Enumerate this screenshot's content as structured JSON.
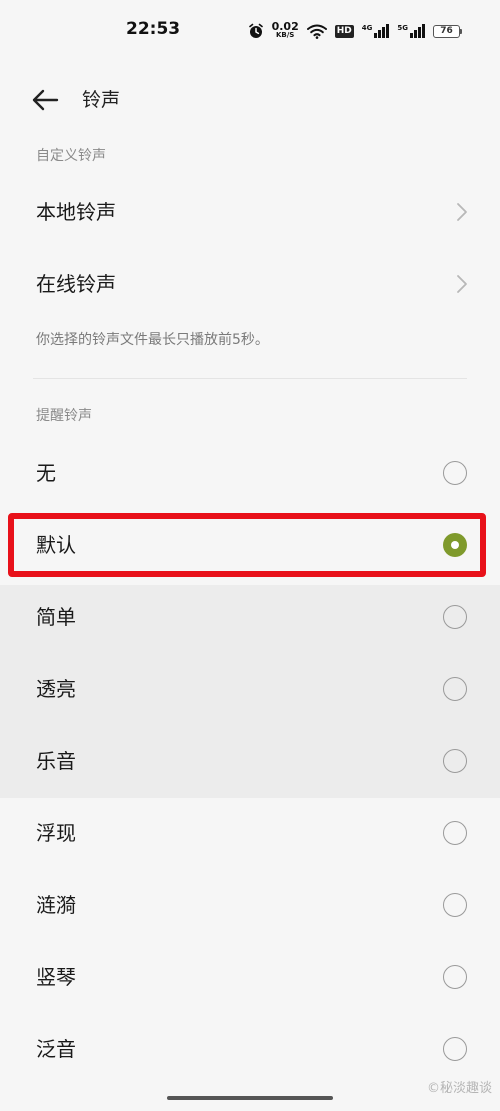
{
  "status_bar": {
    "time": "22:53",
    "net_speed": "0.02",
    "net_unit": "KB/S",
    "hd_label": "HD",
    "net1_tag": "4G",
    "net2_tag": "5G",
    "battery": "76",
    "icons": [
      "alarm-icon",
      "wifi-icon",
      "signal-icon"
    ]
  },
  "header": {
    "title": "铃声"
  },
  "custom_section": {
    "label": "自定义铃声",
    "items": [
      {
        "label": "本地铃声"
      },
      {
        "label": "在线铃声"
      }
    ],
    "hint": "你选择的铃声文件最长只播放前5秒。"
  },
  "reminder_section": {
    "label": "提醒铃声",
    "options": [
      {
        "label": "无",
        "selected": false
      },
      {
        "label": "默认",
        "selected": true
      },
      {
        "label": "简单",
        "selected": false
      },
      {
        "label": "透亮",
        "selected": false
      },
      {
        "label": "乐音",
        "selected": false
      },
      {
        "label": "浮现",
        "selected": false
      },
      {
        "label": "涟漪",
        "selected": false
      },
      {
        "label": "竖琴",
        "selected": false
      },
      {
        "label": "泛音",
        "selected": false
      }
    ]
  },
  "watermark": "©秘淡趣谈",
  "colors": {
    "accent": "#7f9a2c",
    "highlight": "#e8111a",
    "background": "#f6f6f6"
  }
}
